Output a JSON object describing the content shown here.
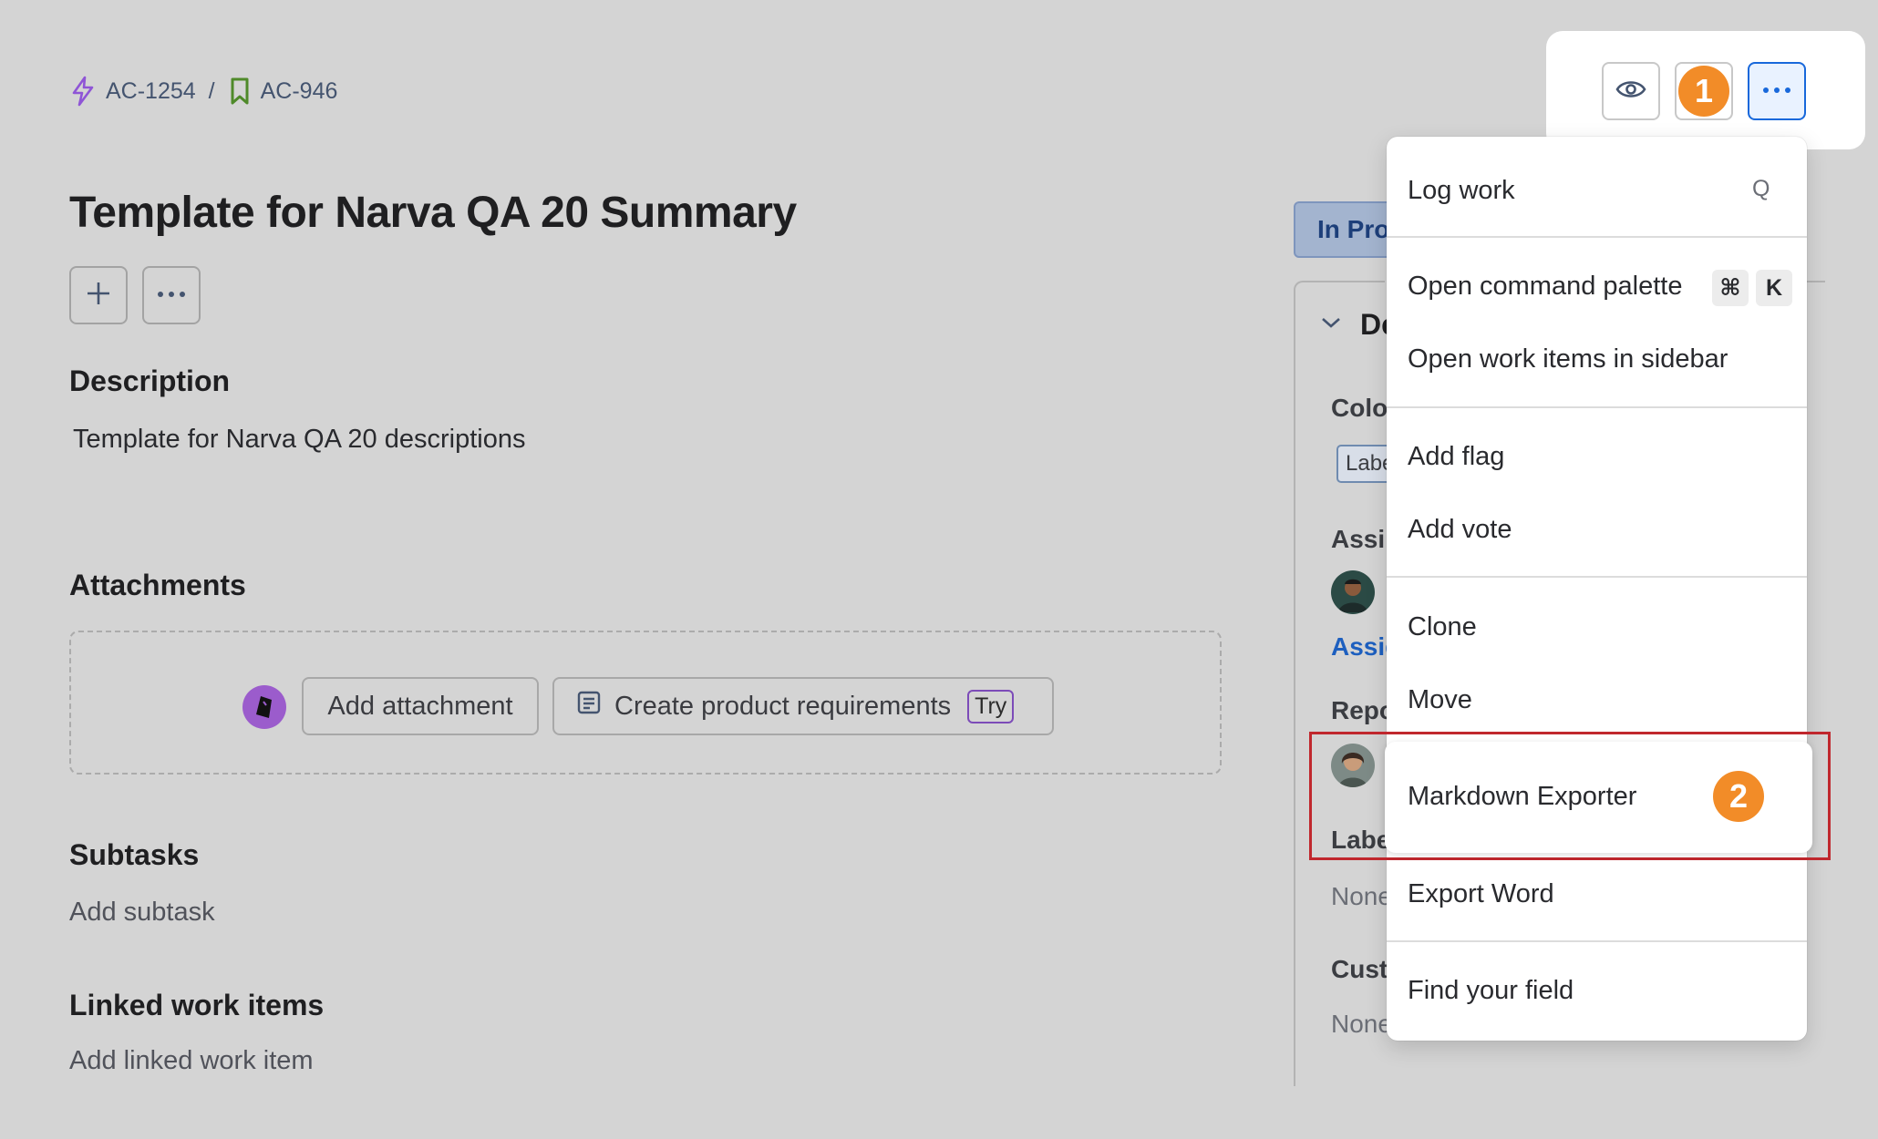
{
  "breadcrumb": {
    "parent": "AC-1254",
    "separator": "/",
    "current": "AC-946"
  },
  "issue": {
    "title": "Template for Narva QA 20 Summary",
    "description_heading": "Description",
    "description_text": "Template for Narva QA 20 descriptions",
    "attachments_heading": "Attachments",
    "add_attachment_label": "Add attachment",
    "create_requirements_label": "Create product requirements",
    "try_badge": "Try",
    "subtasks_heading": "Subtasks",
    "add_subtask_label": "Add subtask",
    "linked_heading": "Linked work items",
    "add_linked_label": "Add linked work item"
  },
  "side_panel": {
    "status": "In Pro",
    "details_heading": "De",
    "color_label": "Colo",
    "label_tag": "Labe",
    "assignee_label": "Assi",
    "assign_link": "Assig",
    "reporter_label": "Repo",
    "labels_label": "Labe",
    "labels_value": "None",
    "custom_label": "Cust",
    "custom_value": "None"
  },
  "top_actions": {
    "watch_icon": "eye-icon",
    "more_icon": "more-horizontal-icon"
  },
  "annotations": {
    "step1": "1",
    "step2": "2",
    "step_color": "#f28c28",
    "highlight_color": "#c0272d"
  },
  "menu": {
    "log_work": "Log work",
    "log_work_shortcut": "Q",
    "open_command_palette": "Open command palette",
    "cmd_key": "⌘",
    "k_key": "K",
    "open_sidebar": "Open work items in sidebar",
    "add_flag": "Add flag",
    "add_vote": "Add vote",
    "clone": "Clone",
    "move": "Move",
    "markdown_exporter": "Markdown Exporter",
    "export_word": "Export Word",
    "find_field": "Find your field"
  }
}
